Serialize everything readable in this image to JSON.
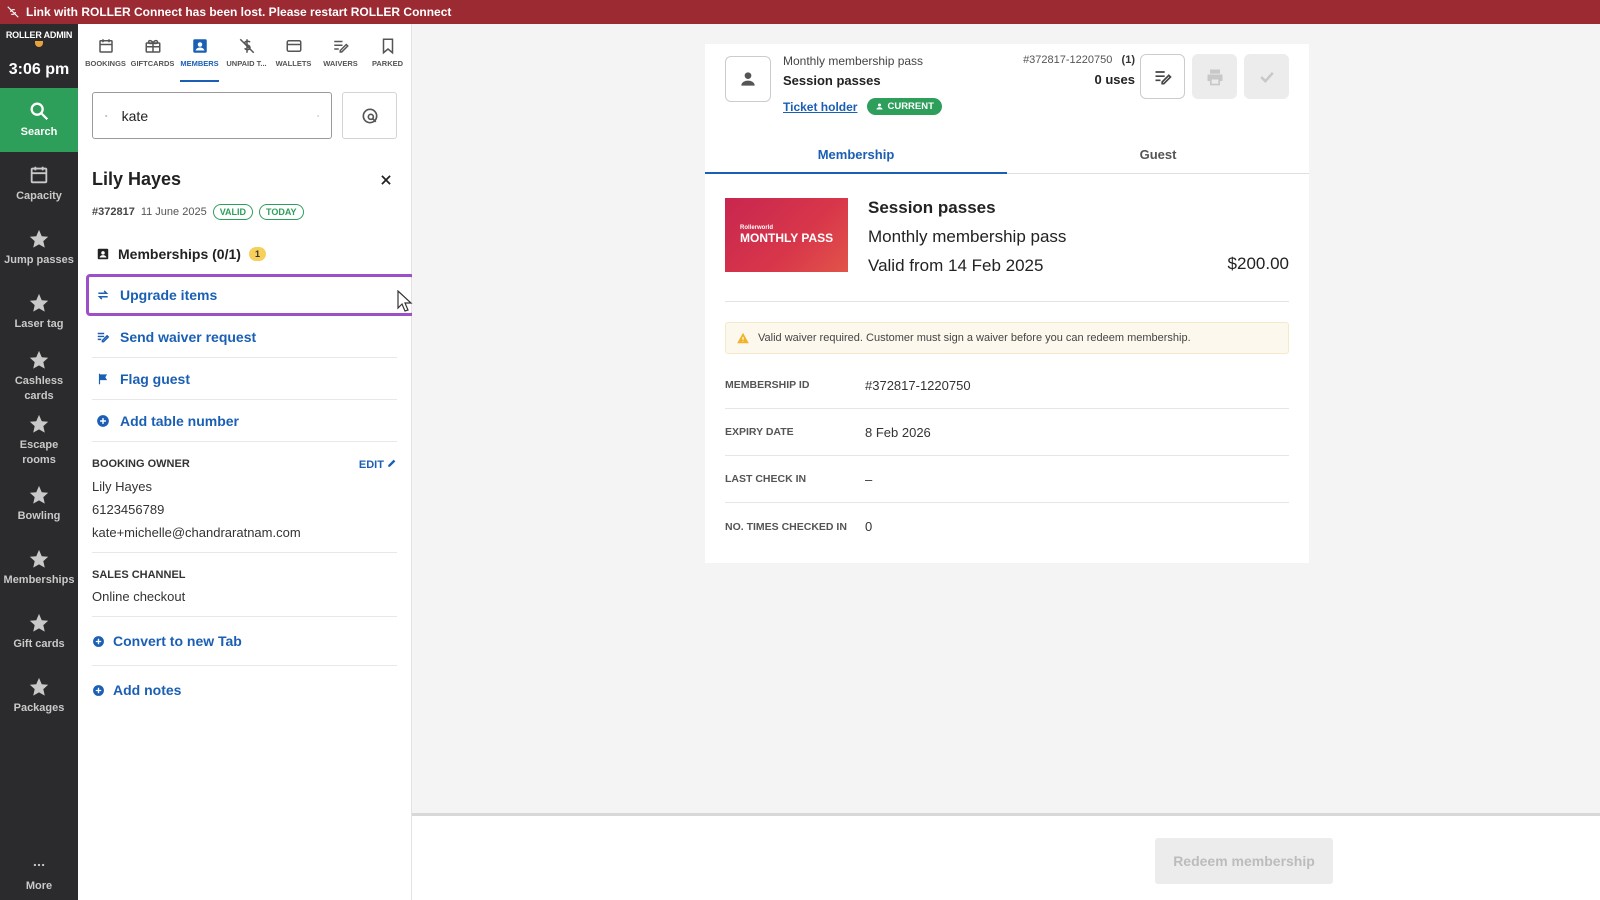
{
  "banner": {
    "text": "Link with ROLLER Connect has been lost. Please restart ROLLER Connect",
    "color": "#9b2a33"
  },
  "rail": {
    "brand": "ROLLER ADMIN",
    "time": "3:06 pm",
    "items": [
      {
        "label": "Search",
        "icon": "search-icon",
        "active": true
      },
      {
        "label": "Capacity",
        "icon": "calendar-icon"
      },
      {
        "label": "Jump passes",
        "icon": "star-icon"
      },
      {
        "label": "Laser tag",
        "icon": "star-icon"
      },
      {
        "label": "Cashless cards",
        "icon": "star-icon"
      },
      {
        "label": "Escape rooms",
        "icon": "star-icon"
      },
      {
        "label": "Bowling",
        "icon": "star-icon"
      },
      {
        "label": "Memberships",
        "icon": "star-icon"
      },
      {
        "label": "Gift cards",
        "icon": "star-icon"
      },
      {
        "label": "Packages",
        "icon": "star-icon"
      }
    ],
    "more": "More"
  },
  "tabs": [
    {
      "label": "BOOKINGS"
    },
    {
      "label": "GIFTCARDS"
    },
    {
      "label": "MEMBERS",
      "active": true
    },
    {
      "label": "UNPAID T..."
    },
    {
      "label": "WALLETS"
    },
    {
      "label": "WAIVERS"
    },
    {
      "label": "PARKED"
    }
  ],
  "search": {
    "value": "kate"
  },
  "guest": {
    "name": "Lily Hayes",
    "id": "#372817",
    "date": "11 June 2025",
    "badges": [
      "VALID",
      "TODAY"
    ],
    "memberships_label": "Memberships (0/1)",
    "memberships_count": "1"
  },
  "actions": {
    "upgrade": "Upgrade items",
    "waiver": "Send waiver request",
    "flag": "Flag guest",
    "table": "Add table number"
  },
  "booking_owner": {
    "heading": "BOOKING OWNER",
    "edit": "EDIT",
    "name": "Lily Hayes",
    "phone": "6123456789",
    "email": "kate+michelle@chandraratnam.com"
  },
  "sales_channel": {
    "heading": "SALES CHANNEL",
    "value": "Online checkout"
  },
  "convert": "Convert to new Tab",
  "notes": "Add notes",
  "card": {
    "product_type": "Monthly membership pass",
    "product_name": "Session passes",
    "ticket_holder": "Ticket holder",
    "status": "CURRENT",
    "ref": "#372817-1220750",
    "ref_count": "(1)",
    "uses": "0 uses",
    "tabs": [
      "Membership",
      "Guest"
    ],
    "image_small": "Rollerworld",
    "image_big": "MONTHLY PASS",
    "title": "Session passes",
    "subtitle": "Monthly membership pass",
    "valid_from": "Valid from 14 Feb 2025",
    "price": "$200.00",
    "warning": "Valid waiver required. Customer must sign a waiver before you can redeem membership.",
    "details": [
      {
        "key": "MEMBERSHIP ID",
        "value": "#372817-1220750"
      },
      {
        "key": "EXPIRY DATE",
        "value": "8 Feb 2026"
      },
      {
        "key": "LAST CHECK IN",
        "value": "–"
      },
      {
        "key": "NO. TIMES CHECKED IN",
        "value": "0"
      }
    ]
  },
  "footer": {
    "redeem": "Redeem membership"
  },
  "colors": {
    "primary": "#1a5fb4",
    "success": "#2e9e5b",
    "highlight": "#9b4fc9",
    "rail": "#2b2b2d"
  }
}
